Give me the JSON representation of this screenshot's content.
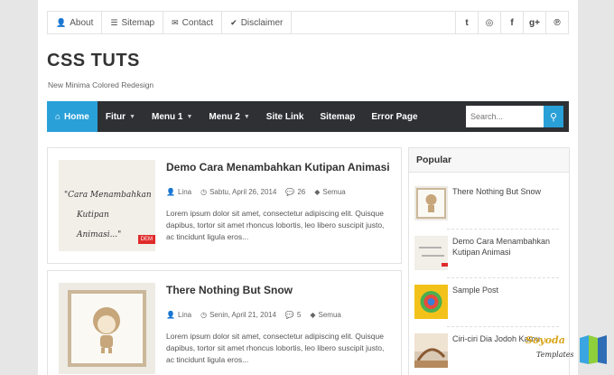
{
  "topbar": {
    "links": [
      {
        "icon": "user-icon",
        "glyph": "👤",
        "label": "About"
      },
      {
        "icon": "list-icon",
        "glyph": "☰",
        "label": "Sitemap"
      },
      {
        "icon": "envelope-icon",
        "glyph": "✉",
        "label": "Contact"
      },
      {
        "icon": "check-circle-icon",
        "glyph": "✔",
        "label": "Disclaimer"
      }
    ],
    "social": [
      {
        "icon": "twitter-icon",
        "glyph": "t"
      },
      {
        "icon": "instagram-icon",
        "glyph": "◎"
      },
      {
        "icon": "facebook-icon",
        "glyph": "f"
      },
      {
        "icon": "google-plus-icon",
        "glyph": "g+"
      },
      {
        "icon": "pinterest-icon",
        "glyph": "℗"
      }
    ]
  },
  "site": {
    "title": "CSS TUTS",
    "tagline": "New Minima Colored Redesign"
  },
  "nav": {
    "home": "Home",
    "home_icon": "home-icon",
    "items": [
      {
        "label": "Fitur",
        "dropdown": true
      },
      {
        "label": "Menu 1",
        "dropdown": true
      },
      {
        "label": "Menu 2",
        "dropdown": true
      },
      {
        "label": "Site Link",
        "dropdown": false
      },
      {
        "label": "Sitemap",
        "dropdown": false
      },
      {
        "label": "Error Page",
        "dropdown": false
      }
    ],
    "search_placeholder": "Search...",
    "search_icon": "search-icon"
  },
  "posts": [
    {
      "title": "Demo Cara Menambahkan Kutipan Animasi",
      "thumb_text_line1": "\"Cara Menambahkan",
      "thumb_text_line2": "Kutipan Animasi...\"",
      "thumb_tag": "DEM",
      "author": "Lina",
      "date": "Sabtu, April 26, 2014",
      "comments": "26",
      "label": "Semua",
      "excerpt": "Lorem ipsum dolor sit amet, consectetur adipiscing elit. Quisque dapibus, tortor sit amet rhoncus lobortis, leo libero suscipit justo, ac tincidunt ligula eros..."
    },
    {
      "title": "There Nothing But Snow",
      "author": "Lina",
      "date": "Senin, April 21, 2014",
      "comments": "5",
      "label": "Semua",
      "excerpt": "Lorem ipsum dolor sit amet, consectetur adipiscing elit. Quisque dapibus, tortor sit amet rhoncus lobortis, leo libero suscipit justo, ac tincidunt ligula eros..."
    }
  ],
  "popular": {
    "heading": "Popular",
    "items": [
      {
        "title": "There Nothing But Snow"
      },
      {
        "title": "Demo Cara Menambahkan Kutipan Animasi"
      },
      {
        "title": "Sample Post"
      },
      {
        "title": "Ciri-ciri Dia Jodoh Kamu"
      }
    ]
  },
  "watermark": {
    "line1": "Soyoda",
    "line2": "Templates"
  }
}
